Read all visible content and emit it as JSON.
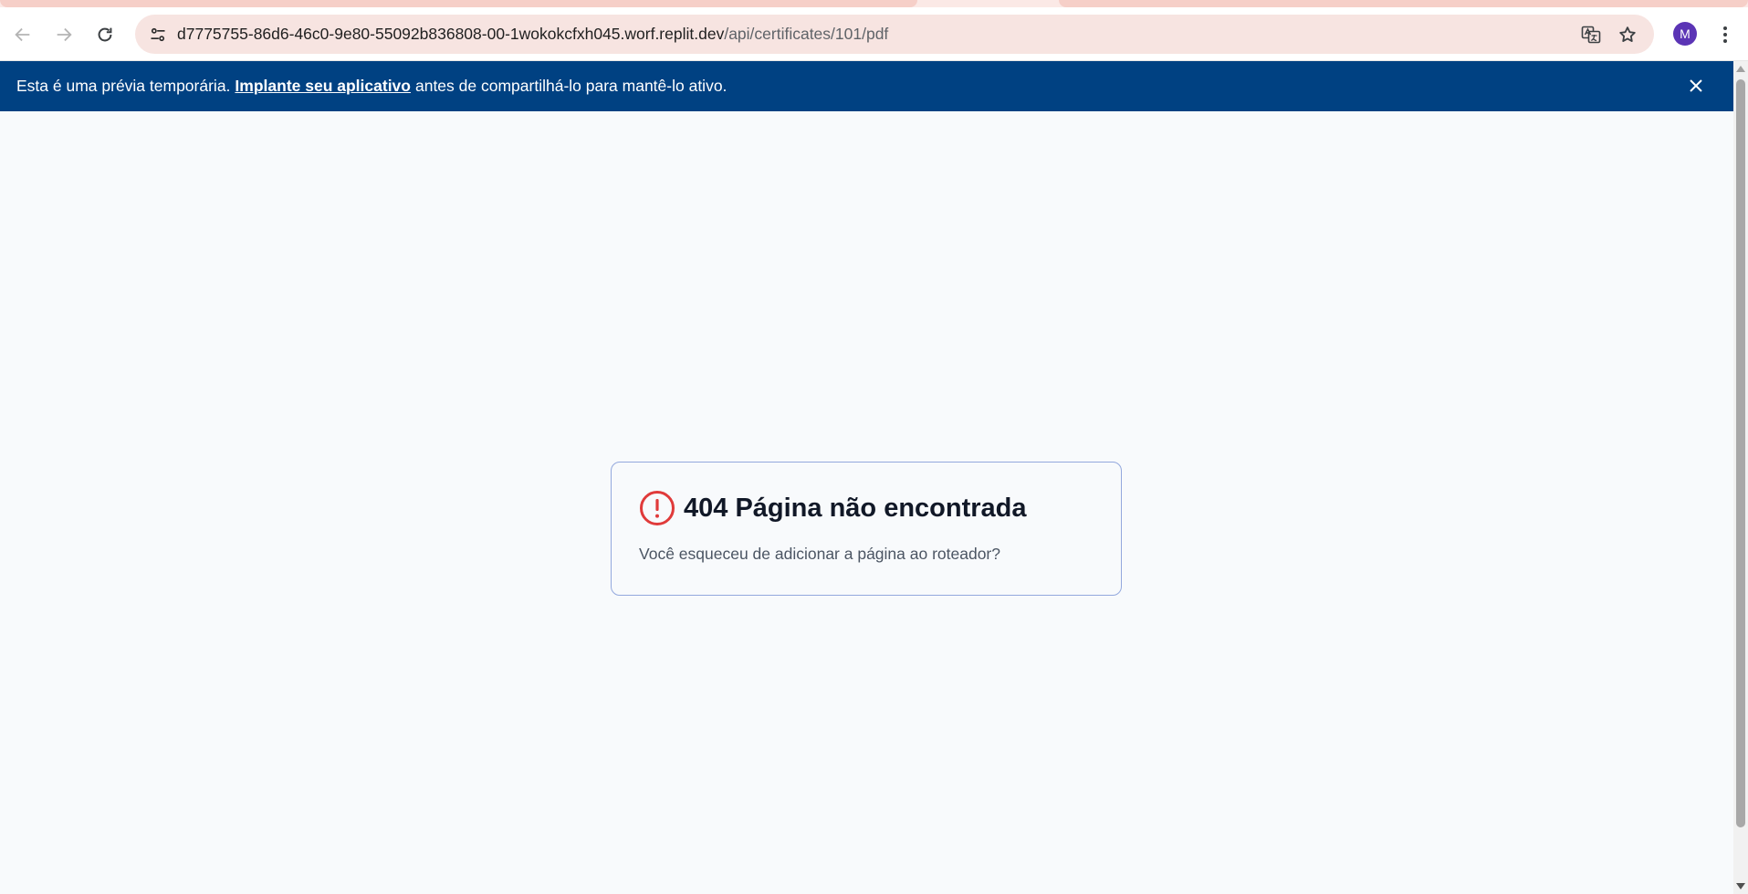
{
  "browser": {
    "url_host": "d7775755-86d6-46c0-9e80-55092b836808-00-1wokokcfxh045.worf.replit.dev",
    "url_path": "/api/certificates/101/pdf",
    "profile_initial": "M",
    "colors": {
      "omnibox_bg": "#f7e4e1",
      "avatar_bg": "#5b34b5"
    }
  },
  "banner": {
    "text_before": "Esta é uma prévia temporária.",
    "link_label": "Implante seu aplicativo",
    "text_after": "antes de compartilhá-lo para mantê-lo ativo.",
    "bg_color": "#004182"
  },
  "error_card": {
    "title": "404 Página não encontrada",
    "message": "Você esqueceu de adicionar a página ao roteador?",
    "icon": "alert-circle-icon",
    "icon_color": "#e03a3a"
  }
}
